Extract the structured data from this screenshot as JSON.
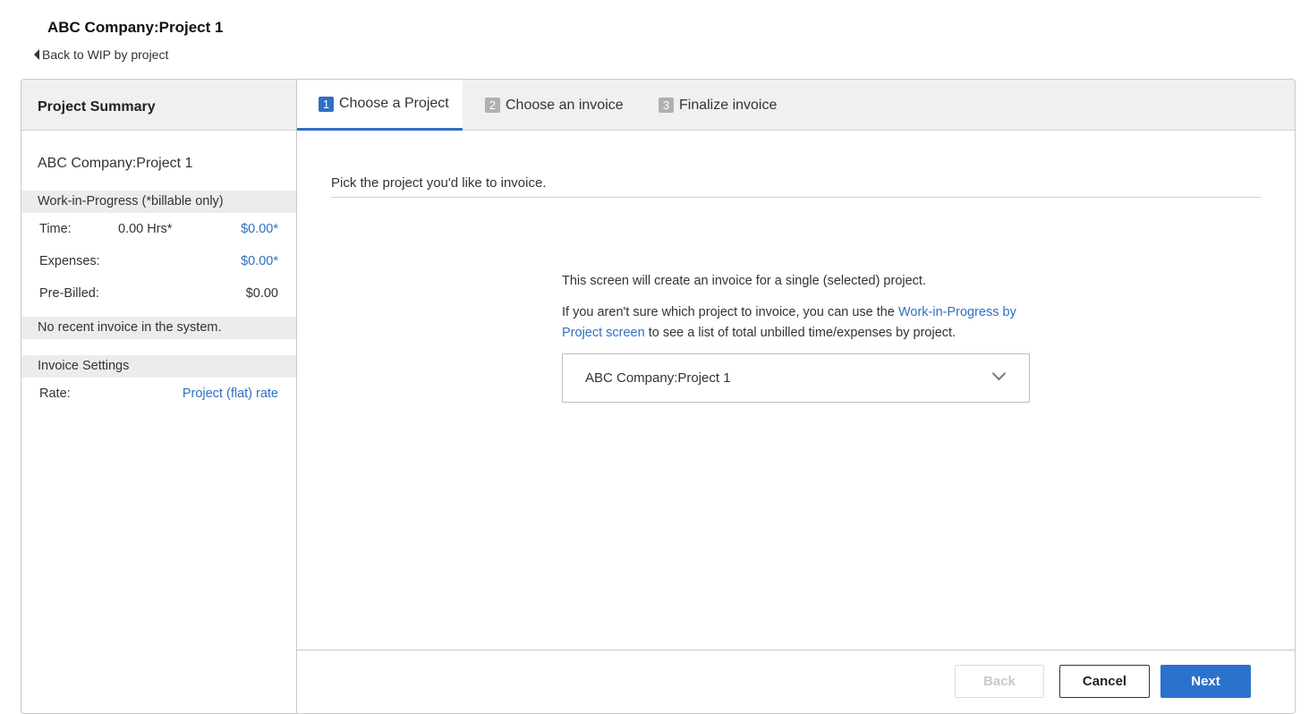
{
  "header": {
    "title": "ABC Company:Project 1",
    "back_label": "Back to WIP by project"
  },
  "sidebar": {
    "title": "Project Summary",
    "project_name": "ABC Company:Project 1",
    "wip_heading": "Work-in-Progress (*billable only)",
    "rows": [
      {
        "label": "Time:",
        "qty": "0.00 Hrs*",
        "value": "$0.00*"
      },
      {
        "label": "Expenses:",
        "qty": "",
        "value": "$0.00*"
      },
      {
        "label": "Pre-Billed:",
        "qty": "",
        "value": "$0.00"
      }
    ],
    "recent_invoice": "No recent invoice in the system.",
    "invoice_settings_heading": "Invoice Settings",
    "rate_label": "Rate:",
    "rate_value": "Project (flat) rate"
  },
  "tabs": [
    {
      "num": "1",
      "label": "Choose a Project",
      "active": true
    },
    {
      "num": "2",
      "label": "Choose an invoice",
      "active": false
    },
    {
      "num": "3",
      "label": "Finalize invoice",
      "active": false
    }
  ],
  "main": {
    "pick_label": "Pick the project you'd like to invoice.",
    "info_line1": "This screen will create an invoice for a single (selected) project.",
    "info_line2_pre": "If you aren't sure which project to invoice, you can use the ",
    "info_line2_link": "Work-in-Progress by Project screen",
    "info_line2_post": " to see a list of total unbilled time/expenses by project.",
    "selected_project": "ABC Company:Project 1"
  },
  "footer": {
    "back_label": "Back",
    "cancel_label": "Cancel",
    "next_label": "Next"
  },
  "colors": {
    "accent": "#2f6fc4",
    "primary_button": "#2b72cc"
  }
}
